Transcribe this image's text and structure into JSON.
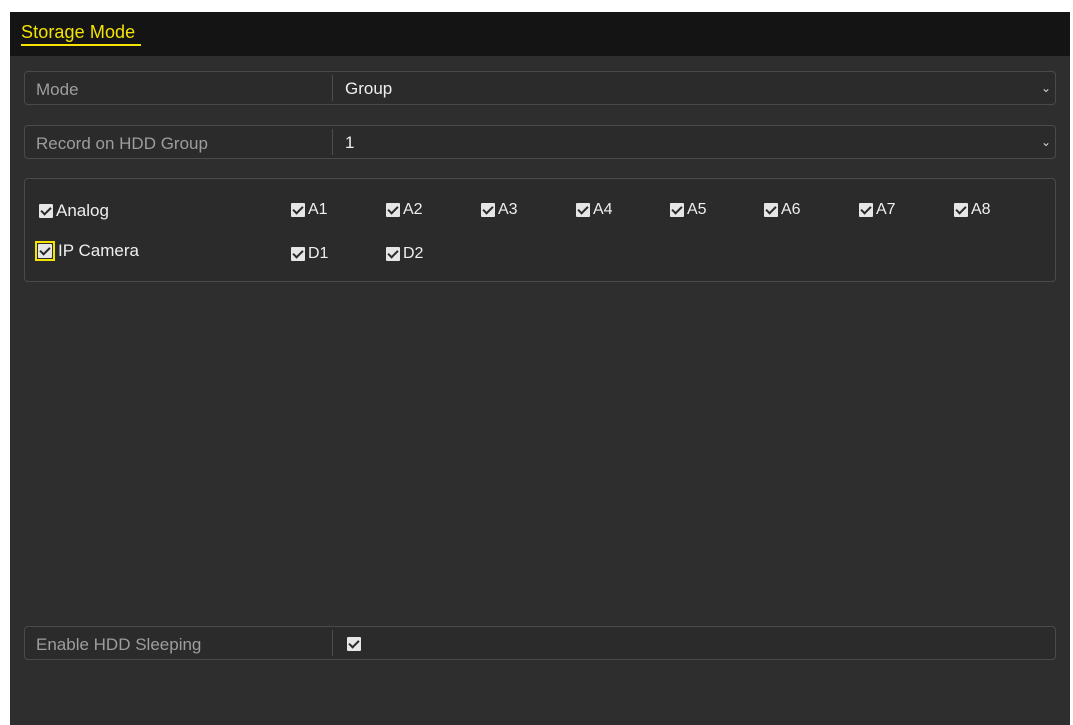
{
  "title": "Storage Mode",
  "mode": {
    "label": "Mode",
    "value": "Group"
  },
  "record_group": {
    "label": "Record on HDD Group",
    "value": "1"
  },
  "analog": {
    "label": "Analog",
    "channels": [
      "A1",
      "A2",
      "A3",
      "A4",
      "A5",
      "A6",
      "A7",
      "A8"
    ]
  },
  "ip_camera": {
    "label": "IP Camera",
    "channels": [
      "D1",
      "D2"
    ]
  },
  "hdd_sleeping": {
    "label": "Enable HDD Sleeping",
    "checked": true
  },
  "colors": {
    "accent": "#f5e300",
    "background": "#2e2e2e",
    "titlebar": "#141414"
  }
}
